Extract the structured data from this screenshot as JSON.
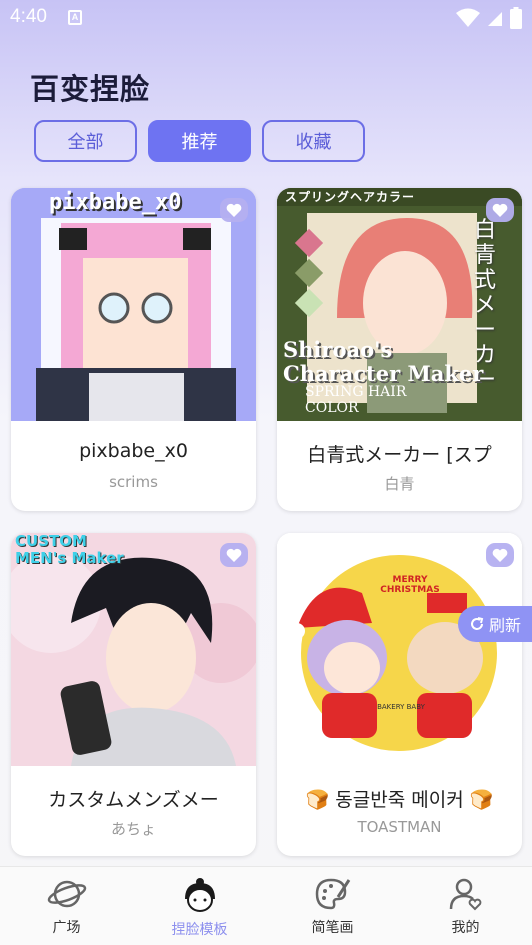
{
  "status_bar": {
    "time": "4:40",
    "notification_letter": "A"
  },
  "page": {
    "title": "百变捏脸"
  },
  "tabs": [
    {
      "label": "全部",
      "active": false
    },
    {
      "label": "推荐",
      "active": true
    },
    {
      "label": "收藏",
      "active": false
    }
  ],
  "cards": [
    {
      "title": "pixbabe_x0",
      "author": "scrims",
      "thumb_text": "pixbabe_x0"
    },
    {
      "title": "白青式メーカー [スプ",
      "author": "白青",
      "thumb_text": "Shiroao's Character Maker",
      "thumb_sub": "SPRING HAIR COLOR",
      "thumb_top": "スプリングヘアカラー",
      "thumb_side": "白青式メーカー"
    },
    {
      "title": "カスタムメンズメー",
      "author": "あちょ",
      "thumb_text": "CUSTOM MEN's Maker"
    },
    {
      "title": "🍞 동글반죽 메이커 🍞",
      "author": "TOASTMAN",
      "thumb_text": "MERRY CHRISTMAS",
      "thumb_sub": "BAKERY BABY"
    }
  ],
  "refresh_button": {
    "label": "刷新"
  },
  "bottom_nav": [
    {
      "label": "广场",
      "icon": "planet-icon",
      "active": false
    },
    {
      "label": "捏脸模板",
      "icon": "face-avatar-icon",
      "active": true
    },
    {
      "label": "简笔画",
      "icon": "palette-icon",
      "active": false
    },
    {
      "label": "我的",
      "icon": "user-heart-icon",
      "active": false
    }
  ],
  "colors": {
    "accent": "#6e73f2",
    "heart": "#b4aff0",
    "active_nav": "#8d90ee"
  }
}
